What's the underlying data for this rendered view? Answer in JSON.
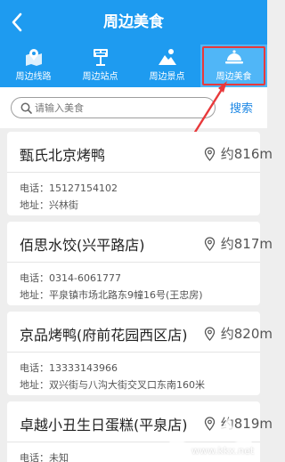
{
  "header": {
    "title": "周边美食"
  },
  "tabs": [
    {
      "label": "周边线路",
      "icon": "map-marker-icon"
    },
    {
      "label": "周边站点",
      "icon": "bus-stop-icon"
    },
    {
      "label": "周边景点",
      "icon": "scenery-icon"
    },
    {
      "label": "周边美食",
      "icon": "food-cloche-icon",
      "active": true
    }
  ],
  "search": {
    "placeholder": "请输入美食",
    "value": "",
    "button_label": "搜索"
  },
  "results": [
    {
      "name": "甄氏北京烤鸭",
      "distance": "约816m",
      "phone": "电话：15127154102",
      "address": "地址：兴林街"
    },
    {
      "name": "佰思水饺(兴平路店)",
      "distance": "约817m",
      "phone": "电话：0314-6061777",
      "address": "地址：平泉镇市场北路东9幢16号(王忠房)"
    },
    {
      "name": "京品烤鸭(府前花园西区店)",
      "distance": "约820m",
      "phone": "电话：13333143966",
      "address": "地址：双兴街与八沟大街交叉口东南160米"
    },
    {
      "name": "卓越小丑生日蛋糕(平泉店)",
      "distance": "约819m",
      "phone": "电话：未知",
      "address": ""
    }
  ],
  "watermark": {
    "text": "www.kkx.net"
  },
  "colors": {
    "primary": "#1e9bf0",
    "active_tab": "#50b6f7",
    "highlight": "#e8393b",
    "link": "#1e88e5"
  }
}
